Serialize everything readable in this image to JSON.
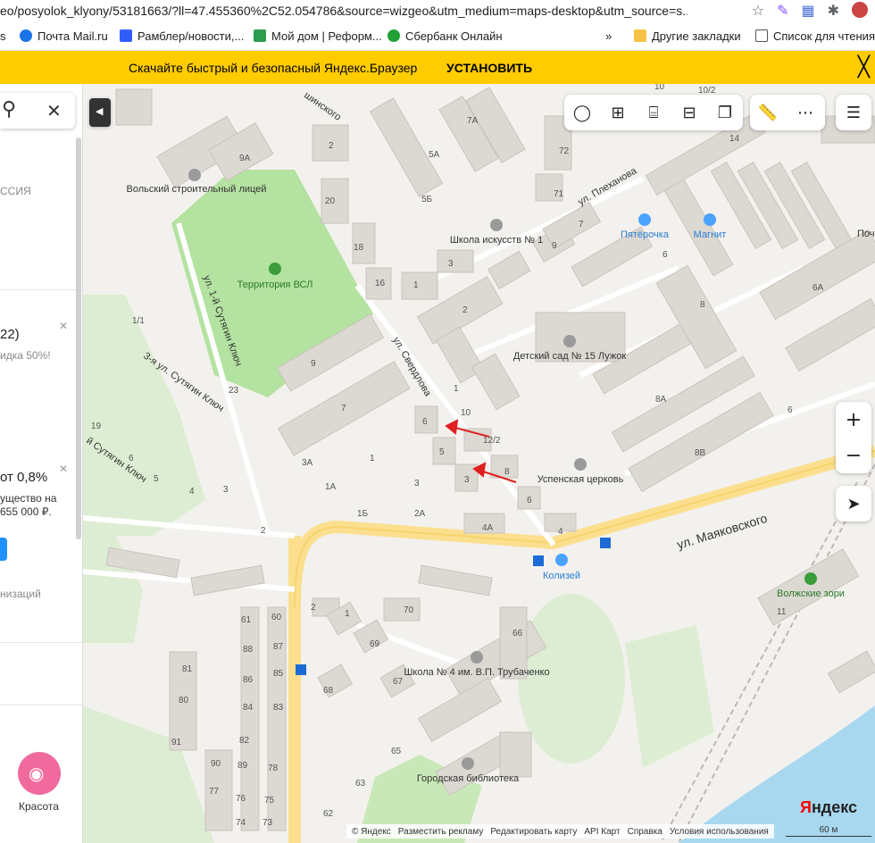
{
  "browser": {
    "url": "eo/posyolok_klyony/53181663/?ll=47.455360%2C52.054786&source=wizgeo&utm_medium=maps-desktop&utm_source=s..."
  },
  "bookmarks": [
    {
      "label": "s",
      "color": "#ffffff"
    },
    {
      "label": "Почта Mail.ru",
      "color": "#1a73e8"
    },
    {
      "label": "Рамблер/новости,...",
      "color": "#315efb"
    },
    {
      "label": "Мой дом | Реформ...",
      "color": "#2e9c4f"
    },
    {
      "label": "Сбербанк Онлайн",
      "color": "#21a038"
    }
  ],
  "bookmarks_more": "»",
  "bookmarks_right": [
    {
      "label": "Другие закладки"
    },
    {
      "label": "Список для чтения"
    }
  ],
  "promo": {
    "text": "Скачайте быстрый и безопасный Яндекс.Браузер",
    "button": "УСТАНОВИТЬ",
    "close": "╳"
  },
  "sidebar": {
    "label_1": "ССИЯ",
    "card1_title": "22)",
    "card1_sub": "идка 50%!",
    "card2_title": "от 0,8%",
    "card2_sub1": "ущество на",
    "card2_sub2": "655 000 ₽.",
    "card3": "низаций",
    "beauty_label": "Красота"
  },
  "map": {
    "streets": [
      "ул. Плеханова",
      "ул. Свердлова",
      "ул. Маяковского",
      "ул. 1-й Сутягин Ключ",
      "3-я ул. Сутягин Ключ",
      "й Сутягин Ключ",
      "шинского"
    ],
    "pois": [
      "Вольский строительный лицей",
      "Территория ВСЛ",
      "Школа искусств № 1",
      "Пятёрочка",
      "Магнит",
      "Детский сад № 15 Лужок",
      "Успенская церковь",
      "Колизей",
      "Волжские зори",
      "Школа № 4 им. В.П. Трубаченко",
      "Городская библиотека",
      "Почт"
    ],
    "house_numbers": [
      "9А",
      "2",
      "7А",
      "5А",
      "5Б",
      "20",
      "18",
      "16",
      "1",
      "3",
      "2",
      "10",
      "9",
      "7",
      "6",
      "5",
      "3",
      "1",
      "12/2",
      "8",
      "6",
      "4",
      "4А",
      "3",
      "2А",
      "2",
      "1",
      "3А",
      "1А",
      "1Б",
      "1/1",
      "23",
      "19",
      "6",
      "5",
      "4",
      "3",
      "2",
      "1",
      "70",
      "69",
      "68",
      "67",
      "66",
      "65",
      "63",
      "62",
      "61",
      "60",
      "88",
      "87",
      "86",
      "85",
      "84",
      "83",
      "82",
      "81",
      "80",
      "91",
      "90",
      "89",
      "78",
      "77",
      "76",
      "75",
      "74",
      "73",
      "72",
      "71",
      "9",
      "7",
      "6",
      "8",
      "8А",
      "8В",
      "6А",
      "6",
      "14",
      "10/2",
      "10",
      "11",
      "9А",
      "1"
    ],
    "footer": [
      "© Яндекс",
      "Разместить рекламу",
      "Редактировать карту",
      "API Карт",
      "Справка",
      "Условия использования"
    ],
    "scale": "60 м",
    "logo": "Яндекс"
  }
}
